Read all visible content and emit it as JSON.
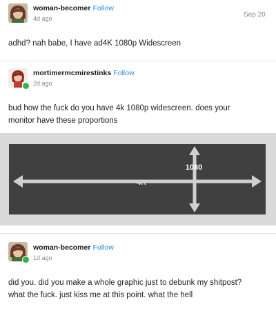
{
  "posts": [
    {
      "username": "woman-becomer",
      "follow_label": "Follow",
      "time_ago": "4d ago",
      "date": "Sep 20",
      "text": "adhd? nah babe, I have ad4K 1080p Widescreen"
    },
    {
      "username": "mortimermcmirestinks",
      "follow_label": "Follow",
      "time_ago": "2d ago",
      "text_line1": "bud how the fuck do you have 4k 1080p widescreen. does your",
      "text_line2": "monitor have these proportions",
      "graphic": {
        "horizontal_label": "4K",
        "vertical_label": "1080"
      }
    },
    {
      "username": "woman-becomer",
      "follow_label": "Follow",
      "time_ago": "1d ago",
      "text_line1": "did you. did you make a whole graphic just to debunk my shitpost?",
      "text_line2": "what the fuck. just kiss me at this point. what the hell"
    }
  ],
  "colors": {
    "follow_link": "#2e8ae6",
    "panel": "#404040",
    "panel_border": "#d9d9d9",
    "arrow": "#d0d0d0",
    "online_badge": "#2fb54a"
  },
  "icons": [
    "avatar-cartoon-icon",
    "online-badge-icon"
  ]
}
